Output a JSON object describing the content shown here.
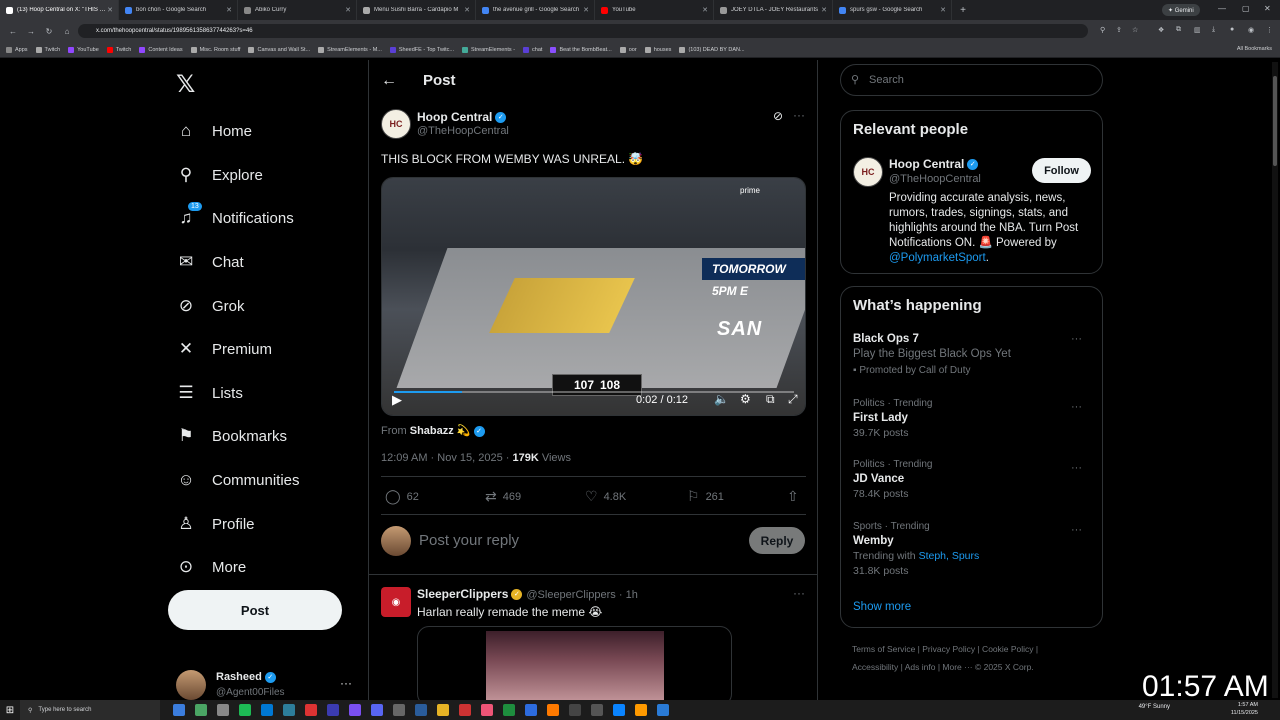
{
  "browser": {
    "tabs": [
      {
        "title": "(13) Hoop Central on X: \"THIS BLO",
        "active": true,
        "color": "#ffffff"
      },
      {
        "title": "bon chon - Google Search",
        "active": false,
        "color": "#4285f4"
      },
      {
        "title": "Abiko Curry",
        "active": false,
        "color": "#888888"
      },
      {
        "title": "Menu Sushi Barra - Cardápio M",
        "active": false,
        "color": "#aaaaaa"
      },
      {
        "title": "the avenue grill - Google Search",
        "active": false,
        "color": "#4285f4"
      },
      {
        "title": "YouTube",
        "active": false,
        "color": "#ff0000"
      },
      {
        "title": "JOEY DTLA - JOEY Restaurants",
        "active": false,
        "color": "#999999"
      },
      {
        "title": "spurs gsw - Google Search",
        "active": false,
        "color": "#4285f4"
      }
    ],
    "new_tab": "+",
    "gemini_label": "✦ Gemini",
    "url": "x.com/thehoopcentral/status/1989561358637744263?s=46",
    "bookmarks": [
      "Apps",
      "Twitch",
      "YouTube",
      "Twitch",
      "Content Ideas",
      "Misc. Room stuff",
      "Canvas and Wall St...",
      "StreamElements - M...",
      "SheedFE - Top Twitc...",
      "StreamElements -",
      "chat",
      "Beat the BombBeat...",
      "oor",
      "houses",
      "(103) DEAD BY DAN..."
    ],
    "all_bookmarks": "All Bookmarks"
  },
  "nav": {
    "items": [
      {
        "label": "Home",
        "icon": "⌂"
      },
      {
        "label": "Explore",
        "icon": "⚲"
      },
      {
        "label": "Notifications",
        "icon": "♫"
      },
      {
        "label": "Chat",
        "icon": "✉"
      },
      {
        "label": "Grok",
        "icon": "⊘"
      },
      {
        "label": "Premium",
        "icon": "✕"
      },
      {
        "label": "Lists",
        "icon": "☰"
      },
      {
        "label": "Bookmarks",
        "icon": "⚑"
      },
      {
        "label": "Communities",
        "icon": "☺"
      },
      {
        "label": "Profile",
        "icon": "♙"
      },
      {
        "label": "More",
        "icon": "⊙"
      }
    ],
    "notif_badge": "13",
    "post_label": "Post",
    "account": {
      "name": "Rasheed",
      "handle": "@Agent00Files"
    }
  },
  "post": {
    "header_title": "Post",
    "author": {
      "name": "Hoop Central",
      "handle": "@TheHoopCentral"
    },
    "text": "THIS BLOCK FROM WEMBY WAS UNREAL. 🤯",
    "video": {
      "time": "0:02 / 0:12",
      "progress": 0.17,
      "score_left": "107",
      "score_right": "108",
      "wall_text": "TOMORROW 5PM E",
      "court_text": "SAN",
      "brand": "prime"
    },
    "from_prefix": "From",
    "from_name": "Shabazz 💫",
    "timestamp": "12:09 AM · Nov 15, 2025 · ",
    "views_count": "179K",
    "views_label": " Views",
    "stats": {
      "replies": "62",
      "reposts": "469",
      "likes": "4.8K",
      "bookmarks": "261"
    },
    "reply_placeholder": "Post your reply",
    "reply_button": "Reply"
  },
  "comment": {
    "name": "SleeperClippers",
    "handle": "@SleeperClippers · 1h",
    "text": "Harlan really remade the meme 😭"
  },
  "sidebar": {
    "search_placeholder": "Search",
    "relevant_title": "Relevant people",
    "person": {
      "name": "Hoop Central",
      "handle": "@TheHoopCentral",
      "follow_label": "Follow",
      "bio": "Providing accurate analysis, news, rumors, trades, signings, stats, and highlights around the NBA. Turn Post Notifications ON. 🚨 Powered by ",
      "bio_link": "@PolymarketSport",
      "bio_end": "."
    },
    "happening_title": "What’s happening",
    "trends": [
      {
        "category": "",
        "title": "Black Ops 7",
        "sub": "Play the Biggest Black Ops Yet",
        "promo": "Promoted by Call of Duty"
      },
      {
        "category": "Politics · Trending",
        "title": "First Lady",
        "sub": "39.7K posts"
      },
      {
        "category": "Politics · Trending",
        "title": "JD Vance",
        "sub": "78.4K posts"
      },
      {
        "category": "Sports · Trending",
        "title": "Wemby",
        "with_prefix": "Trending with ",
        "with_links": "Steph, Spurs",
        "sub": "31.8K posts"
      }
    ],
    "show_more": "Show more",
    "footer_line1": "Terms of Service  |  Privacy Policy  |  Cookie Policy  |",
    "footer_line2": "Accessibility  |  Ads info  |  More ···  © 2025 X Corp."
  },
  "overlay_clock": "01:57 AM",
  "taskbar": {
    "search_placeholder": "Type here to search",
    "weather": "49°F Sunny",
    "time": "1:57 AM",
    "date": "11/15/2025"
  },
  "colors": {
    "accent": "#1d9bf0",
    "background": "#000000",
    "text": "#e7e9ea",
    "muted": "#71767b"
  }
}
